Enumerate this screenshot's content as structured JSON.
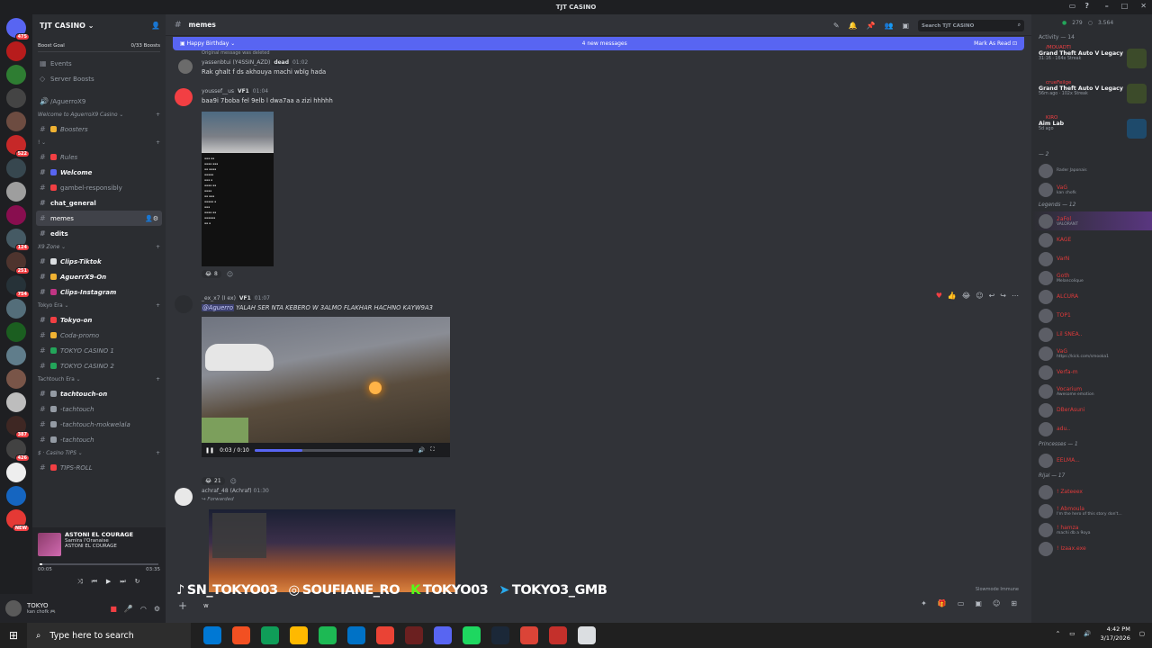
{
  "window": {
    "title": "TJT CASINO",
    "controls": [
      "–",
      "□",
      "✕"
    ]
  },
  "servers": {
    "badges": [
      "475",
      "",
      "",
      "",
      "",
      "522",
      "",
      "",
      "",
      "124",
      "251",
      "754",
      "",
      "",
      "",
      "",
      "",
      "387",
      "426",
      "",
      "",
      "NEW"
    ]
  },
  "guild": {
    "name": "TJT CASINO",
    "boost_goal": "Boost Goal",
    "boost_count": "0/33 Boosts"
  },
  "channels": [
    {
      "type": "ch",
      "label": "Events",
      "icon": "calendar-icon"
    },
    {
      "type": "ch",
      "label": "Server Boosts",
      "icon": "boost-icon"
    },
    {
      "type": "gap"
    },
    {
      "type": "ch",
      "label": "/AguerroX9",
      "icon": "voice-icon"
    },
    {
      "type": "cat",
      "label": "Welcome to AguerroX9 Casino ⌄",
      "italic": true
    },
    {
      "type": "ch",
      "label": "Boosters",
      "italic": true,
      "emoji": "#f0b232"
    },
    {
      "type": "cat",
      "label": "!  ⌄",
      "italic": false
    },
    {
      "type": "ch",
      "label": "Rules",
      "italic": true,
      "emoji": "#f23f43"
    },
    {
      "type": "ch",
      "label": "Welcome",
      "bold": true,
      "italic": true,
      "emoji": "#5865f2"
    },
    {
      "type": "ch",
      "label": "gambel-responsibly",
      "emoji": "#f23f43"
    },
    {
      "type": "ch",
      "label": "chat_general",
      "bold": true
    },
    {
      "type": "ch",
      "label": "memes",
      "active": true
    },
    {
      "type": "ch",
      "label": "edits",
      "bold": true
    },
    {
      "type": "cat",
      "label": "X9 Zone ⌄",
      "italic": true
    },
    {
      "type": "ch",
      "label": "Clips-Tiktok",
      "bold": true,
      "italic": true,
      "emoji": "#dbdee1"
    },
    {
      "type": "ch",
      "label": "AguerrX9-On",
      "bold": true,
      "italic": true,
      "emoji": "#f0b232"
    },
    {
      "type": "ch",
      "label": "Clips-Instagram",
      "bold": true,
      "italic": true,
      "emoji": "#c13584"
    },
    {
      "type": "cat",
      "label": "Tokyo Era ⌄",
      "italic": false
    },
    {
      "type": "ch",
      "label": "Tokyo-on",
      "bold": true,
      "italic": true,
      "emoji": "#f23f43"
    },
    {
      "type": "ch",
      "label": "Coda-promo",
      "italic": true,
      "emoji": "#f0b232"
    },
    {
      "type": "ch",
      "label": "TOKYO CASINO 1",
      "italic": true,
      "emoji": "#23a55a"
    },
    {
      "type": "ch",
      "label": "TOKYO CASINO 2",
      "italic": true,
      "emoji": "#23a55a"
    },
    {
      "type": "cat",
      "label": "Tachtouch Era ⌄",
      "italic": false
    },
    {
      "type": "ch",
      "label": "tachtouch-on",
      "bold": true,
      "italic": true,
      "emoji": "#949ba4"
    },
    {
      "type": "ch",
      "label": "-tachtouch",
      "italic": true,
      "emoji": "#949ba4"
    },
    {
      "type": "ch",
      "label": "-tachtouch-mokwelala",
      "italic": true,
      "emoji": "#949ba4"
    },
    {
      "type": "ch",
      "label": "-tachtouch",
      "italic": true,
      "emoji": "#949ba4"
    },
    {
      "type": "cat",
      "label": "$ · Casino TIPS ⌄",
      "italic": true
    },
    {
      "type": "ch",
      "label": "TIPS-ROLL",
      "italic": true,
      "emoji": "#f23f43"
    }
  ],
  "player": {
    "title": "ASTONI EL COURAGE",
    "artist": "Samira l'Oranaise",
    "album": "ASTONI EL COURAGE",
    "elapsed": "00:05",
    "duration": "03:35",
    "progress": 0.025
  },
  "user": {
    "name": "TOKYO",
    "status": "kan chofk 🎮"
  },
  "channel_header": {
    "name": "memes",
    "search_placeholder": "Search TJT CASINO"
  },
  "new_messages_bar": {
    "left": "Happy Birthday",
    "center": "4 new messages",
    "right": "Mark As Read"
  },
  "messages": [
    {
      "reply_hint": "Original message was deleted",
      "author": "yassenbtui (Y4SSIN_AZD)",
      "tag": "dead",
      "time": "01:02",
      "text": "Rak ghalt f ds akhouya machi wblg hada"
    },
    {
      "author": "youssef__us",
      "tag": "VF1",
      "time": "01:04",
      "text": "baa9i 7boba fel 9elb l dwa7aa a zizi hhhhh",
      "reaction_count": "8"
    },
    {
      "author": "_ex_x7 (I ex)",
      "tag": "VF1",
      "time": "01:07",
      "mention": "@Aguerro",
      "text": "YALAH SER NTA KEBERO W 3ALMO FLAKHAR  HACHNO KAYW9A3",
      "video_time": "0:03 / 0:10",
      "reaction_count": "21"
    },
    {
      "author": "achraf_48 (Achraf)",
      "time": "01:30",
      "forwarded": "Forwarded"
    }
  ],
  "composer": {
    "draft": "w",
    "slowmode": "Slowmode Immune"
  },
  "overlay": [
    "SN_TOKYO03",
    "SOUFIANE_RO",
    "TOKYO03",
    "TOKYO3_GMB"
  ],
  "members_panel": {
    "stats_online": "279",
    "stats_total": "3.564",
    "activity_title": "Activity — 14",
    "activities": [
      {
        "who": "/MOUADTI",
        "game": "Grand Theft Auto V Legacy",
        "sub": "31:16 · 164x Streak"
      },
      {
        "who": "crueFeilge",
        "game": "Grand Theft Auto V Legacy",
        "sub": "56m ago · 102x Streak"
      },
      {
        "who": "KIRO",
        "game": "Aim Lab",
        "sub": "5d ago"
      }
    ],
    "groups": [
      {
        "label": "— 2",
        "members": [
          {
            "name": "",
            "sub": "Rader Japonais"
          },
          {
            "name": "VaG",
            "sub": "kan chofk"
          }
        ]
      },
      {
        "label": "Legends — 12",
        "members": [
          {
            "name": "2aFol",
            "sub": "VALORANT",
            "hl": true
          },
          {
            "name": "KAGE"
          },
          {
            "name": "VarN"
          },
          {
            "name": "Goth",
            "sub": "Melancolique"
          },
          {
            "name": "ALCURA"
          },
          {
            "name": "TOP1"
          },
          {
            "name": "Lil SNEA.."
          },
          {
            "name": "VaG",
            "sub": "https://kick.com/smooka1"
          },
          {
            "name": "Verfa-m"
          },
          {
            "name": "Vocarium",
            "sub": "Awesome emotion"
          },
          {
            "name": "DBerAsuni"
          },
          {
            "name": "adu.."
          }
        ]
      },
      {
        "label": "Princesses — 1",
        "members": [
          {
            "name": "EELMA..."
          }
        ]
      },
      {
        "label": "Rijal — 17",
        "members": [
          {
            "name": "! Zateeex"
          },
          {
            "name": "! Abmoula",
            "sub": "I'm the hero of this story don't..."
          },
          {
            "name": "! hamza",
            "sub": "machi db a 9oya"
          },
          {
            "name": "! Izaax.exe"
          }
        ]
      }
    ]
  },
  "taskbar": {
    "search_placeholder": "Type here to search",
    "time": "4:42 PM",
    "date": "3/17/2026",
    "apps": [
      "#0078d4",
      "#f25022",
      "#0f9d58",
      "#ffb900",
      "#1db954",
      "#0072c6",
      "#ea4335",
      "#6b2020",
      "#5865f2",
      "#1ed760",
      "#1b2838",
      "#db4437",
      "#c4302b",
      "#dbdee1"
    ]
  }
}
